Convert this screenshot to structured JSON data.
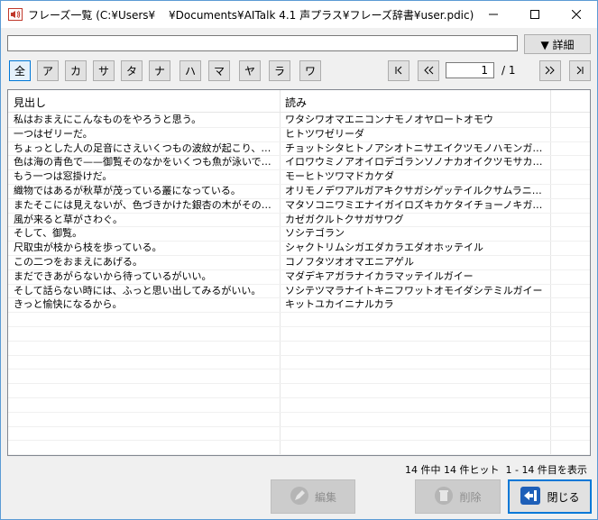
{
  "window": {
    "title": "フレーズ一覧 (C:¥Users¥",
    "title_path": "¥Documents¥AITalk 4.1 声プラス¥フレーズ辞書¥user.pdic)",
    "controls": [
      "minimize-icon",
      "maximize-icon",
      "close-icon"
    ]
  },
  "search": {
    "value": "",
    "placeholder": ""
  },
  "detail_button": {
    "label": "▼ 詳細"
  },
  "kana_filters": [
    "全",
    "ア",
    "カ",
    "サ",
    "タ",
    "ナ",
    "ハ",
    "マ",
    "ヤ",
    "ラ",
    "ワ"
  ],
  "kana_selected": "全",
  "pager": {
    "first_label": "|<",
    "prev_label": "<<",
    "page": "1",
    "total": "/ 1",
    "next_label": ">>",
    "last_label": ">|"
  },
  "table": {
    "columns": [
      "見出し",
      "読み"
    ],
    "rows": [
      [
        "私はおまえにこんなものをやろうと思う。",
        "ワタシワオマエニコンナモノオヤロートオモウ"
      ],
      [
        "一つはゼリーだ。",
        "ヒトツワゼリーダ"
      ],
      [
        "ちょっとした人の足音にさえいくつもの波紋が起こり、風が吹いてもさざなみが立つ。",
        "チョットシタヒトノアシオトニサエイクツモノハモンガオコリカゼガフイテモサザナミガタツ"
      ],
      [
        "色は海の青色で——御覧そのなかをいくつも魚が泳いでいる。",
        "イロワウミノアオイロデゴランソノナカオイクツモサカナガオヨイデイル"
      ],
      [
        "もう一つは窓掛けだ。",
        "モーヒトツワマドカケダ"
      ],
      [
        "織物ではあるが秋草が茂っている叢になっている。",
        "オリモノデワアルガアキクサガシゲッテイルクサムラニナッテイル"
      ],
      [
        "またそこには見えないが、色づきかけた銀杏の木がその上に生えている。",
        "マタソコニワミエナイガイロズキカケタイチョーノキガソノウエニハエテイル"
      ],
      [
        "風が来ると草がさわぐ。",
        "カゼガクルトクサガサワグ"
      ],
      [
        "そして、御覧。",
        "ソシテゴラン"
      ],
      [
        "尺取虫が枝から枝を歩っている。",
        "シャクトリムシガエダカラエダオホッテイル"
      ],
      [
        "この二つをおまえにあげる。",
        "コノフタツオオマエニアゲル"
      ],
      [
        "まだできあがらないから待っているがいい。",
        "マダデキアガラナイカラマッテイルガイー"
      ],
      [
        "そして話らない時には、ふっと思い出してみるがいい。",
        "ソシテツマラナイトキニフワットオモイダシテミルガイー"
      ],
      [
        "きっと愉快になるから。",
        "キットユカイニナルカラ"
      ]
    ]
  },
  "status": {
    "text": "14 件中 14 件ヒット  1 - 14 件目を表示"
  },
  "buttons": {
    "edit": {
      "label": "編集",
      "icon": "pencil-icon"
    },
    "delete": {
      "label": "削除",
      "icon": "trash-icon"
    },
    "close": {
      "label": "閉じる",
      "icon": "exit-icon"
    }
  },
  "colors": {
    "accent": "#0078d7",
    "border": "#5b9bd5",
    "disabled_bg": "#cccccc"
  }
}
